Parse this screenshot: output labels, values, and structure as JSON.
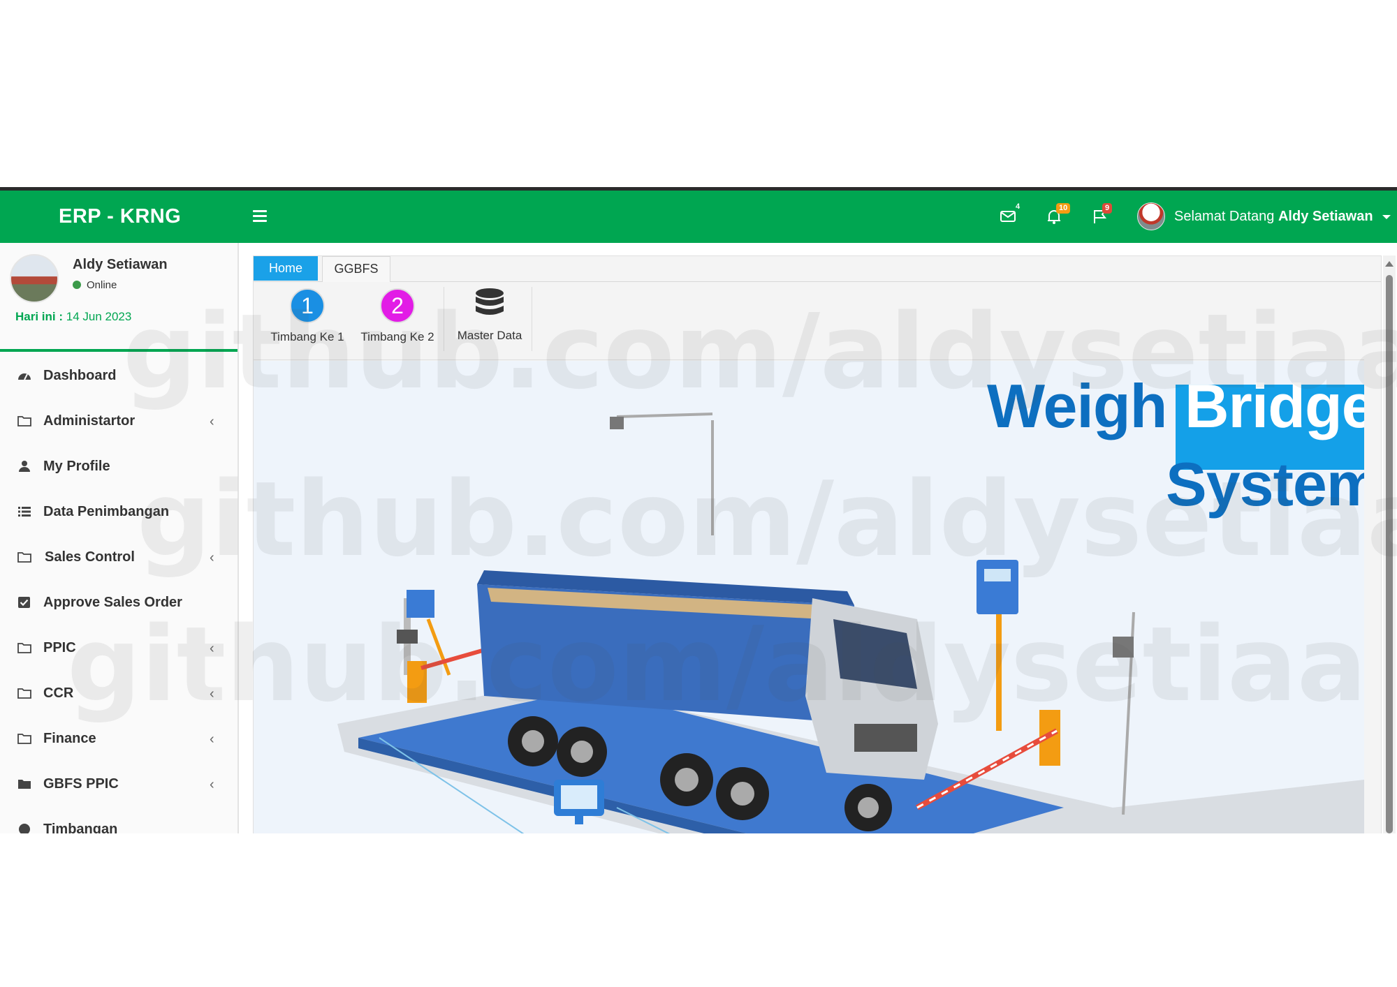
{
  "header": {
    "brand": "ERP - KRNG",
    "mail_count": "4",
    "notif_count": "10",
    "flag_count": "9",
    "greeting": "Selamat Datang",
    "username": "Aldy Setiawan"
  },
  "sidebar": {
    "user_name": "Aldy Setiawan",
    "status": "Online",
    "date_label": "Hari ini :",
    "date_value": "14 Jun 2023",
    "items": [
      {
        "label": "Dashboard",
        "icon": "dashboard-icon",
        "has_children": false
      },
      {
        "label": "Administartor",
        "icon": "folder-icon",
        "has_children": true
      },
      {
        "label": "My Profile",
        "icon": "user-icon",
        "has_children": false
      },
      {
        "label": "Data Penimbangan",
        "icon": "list-icon",
        "has_children": false
      },
      {
        "label": "Sales Control",
        "icon": "folder-icon",
        "has_children": true
      },
      {
        "label": "Approve Sales Order",
        "icon": "check-square-icon",
        "has_children": false
      },
      {
        "label": "PPIC",
        "icon": "folder-icon",
        "has_children": true
      },
      {
        "label": "CCR",
        "icon": "folder-icon",
        "has_children": true
      },
      {
        "label": "Finance",
        "icon": "folder-icon",
        "has_children": true
      },
      {
        "label": "GBFS PPIC",
        "icon": "folder-filled-icon",
        "has_children": true
      },
      {
        "label": "Timbangan",
        "icon": "circle-icon",
        "has_children": false
      }
    ]
  },
  "tabs": {
    "home": "Home",
    "ggbfs": "GGBFS"
  },
  "ribbon": {
    "btn1_num": "1",
    "btn1_label": "Timbang Ke 1",
    "btn2_num": "2",
    "btn2_label": "Timbang Ke 2",
    "btn3_label": "Master Data"
  },
  "hero": {
    "word1": "Weigh",
    "word2": "Bridge",
    "word3": "System"
  },
  "watermark": "github.com/aldysetiaa",
  "colors": {
    "header_green": "#00a651",
    "tab_blue": "#1aa1e8",
    "hero_blue": "#0d6fc0",
    "badge_mail": "#ffffff",
    "badge_notif": "#f39c12",
    "badge_flag": "#dd4b39"
  }
}
